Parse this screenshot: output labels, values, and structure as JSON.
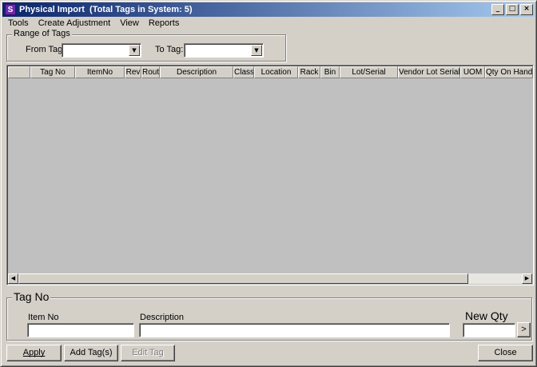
{
  "window": {
    "title": "Physical Import  (Total Tags in System: 5)",
    "app_icon_glyph": "S"
  },
  "title_buttons": {
    "minimize": "_",
    "maximize": "□",
    "close": "×"
  },
  "menu": [
    "Tools",
    "Create Adjustment",
    "View",
    "Reports"
  ],
  "range_group": {
    "legend": "Range of Tags",
    "from_label": "From Tag:",
    "from_value": "",
    "to_label": "To Tag:",
    "to_value": ""
  },
  "grid": {
    "columns": [
      "",
      "Tag No",
      "ItemNo",
      "Rev",
      "Rout",
      "Description",
      "Class",
      "Location",
      "Rack",
      "Bin",
      "Lot/Serial",
      "Vendor Lot Serial",
      "UOM",
      "Qty On Hand"
    ],
    "rows": []
  },
  "tag_group": {
    "legend": "Tag No",
    "item_no_label": "Item No",
    "item_no_value": "",
    "description_label": "Description",
    "description_value": "",
    "new_qty_label": "New Qty",
    "new_qty_value": "",
    "next_button": ">"
  },
  "buttons": {
    "apply": "Apply",
    "add_tags": "Add Tag(s)",
    "edit_tag": "Edit Tag",
    "close": "Close"
  },
  "icons": {
    "combo_arrow": "▼",
    "scroll_left": "◀",
    "scroll_right": "▶"
  }
}
